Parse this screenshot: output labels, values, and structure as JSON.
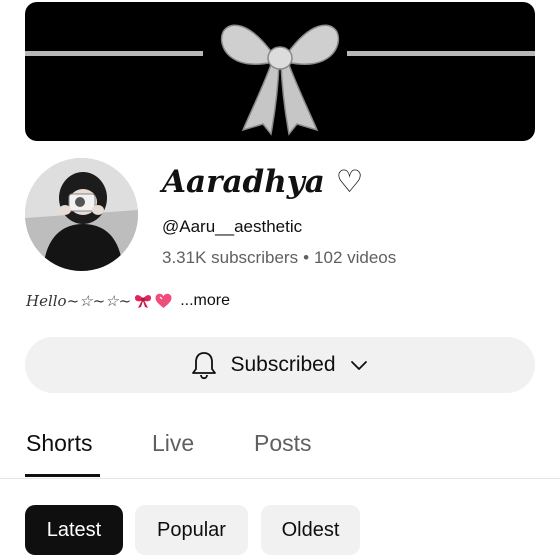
{
  "channel": {
    "name": "Aaradhya ♡",
    "handle": "@Aaru__aesthetic",
    "subscribers": "3.31K subscribers",
    "separator": "•",
    "videos": "102 videos",
    "description": "Hello~☆~☆~",
    "more": "...more"
  },
  "subscribe_button": {
    "label": "Subscribed"
  },
  "tabs": [
    {
      "label": "Shorts",
      "active": true
    },
    {
      "label": "Live",
      "active": false
    },
    {
      "label": "Posts",
      "active": false
    }
  ],
  "chips": [
    {
      "label": "Latest",
      "selected": true
    },
    {
      "label": "Popular",
      "selected": false
    },
    {
      "label": "Oldest",
      "selected": false
    }
  ],
  "icons": {
    "banner": "ribbon-bow-icon",
    "description_emoji_1": "red-bow-emoji-icon",
    "description_emoji_2": "heart-emoji-icon",
    "subscribe": "bell-icon",
    "subscribe_menu": "chevron-down-icon"
  },
  "colors": {
    "banner_background": "#000000",
    "chip_selected": "#0f0f0f",
    "chip_unselected": "#f1f1f1",
    "secondary_text": "#606060"
  }
}
